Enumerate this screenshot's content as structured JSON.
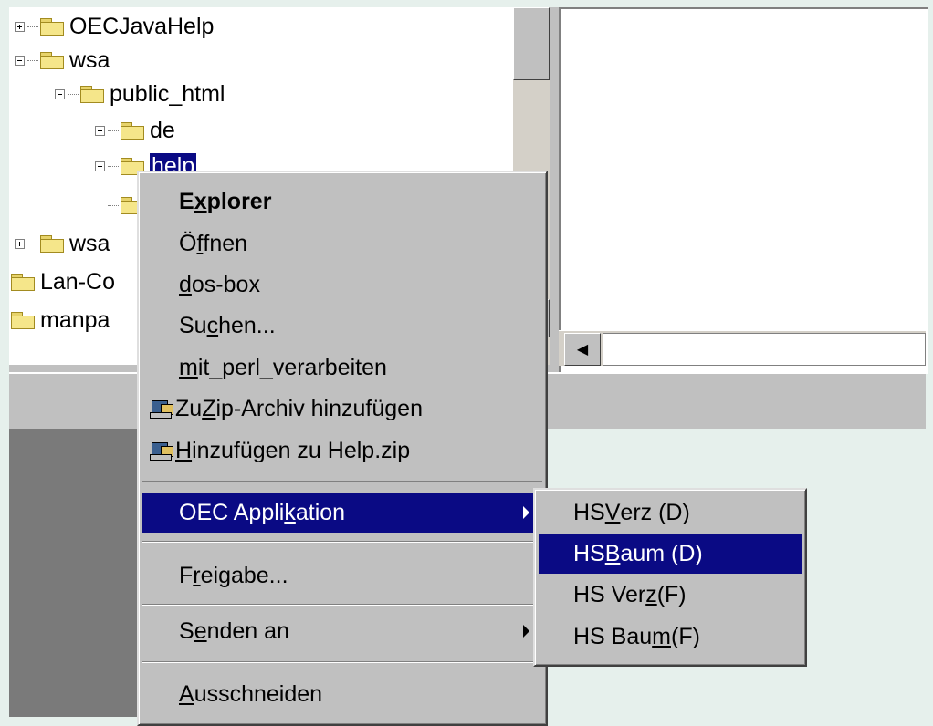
{
  "tree": {
    "items": [
      {
        "label": "OECJavaHelp",
        "expander": "plus"
      },
      {
        "label": "wsa",
        "expander": "minus"
      },
      {
        "label": "public_html",
        "expander": "minus"
      },
      {
        "label": "de",
        "expander": "plus"
      },
      {
        "label": "help",
        "expander": "plus",
        "selected": true
      },
      {
        "label": "",
        "expander": "none"
      },
      {
        "label": "wsa",
        "expander": "plus"
      },
      {
        "label": "Lan-Co",
        "expander": "none"
      },
      {
        "label": "manpa",
        "expander": "none"
      }
    ]
  },
  "context_menu": {
    "explorer": {
      "pre": "E",
      "u": "x",
      "post": "plorer"
    },
    "oeffnen": {
      "pre": "Ö",
      "u": "f",
      "post": "fnen"
    },
    "dosbox": {
      "pre": "",
      "u": "d",
      "post": "os-box"
    },
    "suchen": {
      "pre": "Su",
      "u": "c",
      "post": "hen..."
    },
    "perl": {
      "pre": "",
      "u": "m",
      "post": "it_perl_verarbeiten"
    },
    "zip_add": {
      "pre": "Zu ",
      "u": "Z",
      "post": "ip-Archiv hinzufügen"
    },
    "zip_help": {
      "pre": "",
      "u": "H",
      "post": "inzufügen zu Help.zip"
    },
    "oec": {
      "pre": "OEC Appli",
      "u": "k",
      "post": "ation"
    },
    "freigabe": {
      "pre": "F",
      "u": "r",
      "post": "eigabe..."
    },
    "senden": {
      "pre": "S",
      "u": "e",
      "post": "nden an"
    },
    "ausschneiden": {
      "pre": "",
      "u": "A",
      "post": "usschneiden"
    }
  },
  "submenu": {
    "verz_d": {
      "pre": "HS ",
      "u": "V",
      "post": "erz (D)"
    },
    "baum_d": {
      "pre": "HS ",
      "u": "B",
      "post": "aum (D)"
    },
    "verz_f": {
      "pre": "HS Ver",
      "u": "z",
      "post": " (F)"
    },
    "baum_f": {
      "pre": "HS Bau",
      "u": "m",
      "post": " (F)"
    }
  },
  "colors": {
    "highlight": "#0a0a84",
    "menu_bg": "#c0c0c0",
    "folder": "#f5e68a"
  },
  "icons": {
    "folder": "folder-icon",
    "zip": "winzip-icon",
    "submenu_arrow": "chevron-right-icon"
  }
}
